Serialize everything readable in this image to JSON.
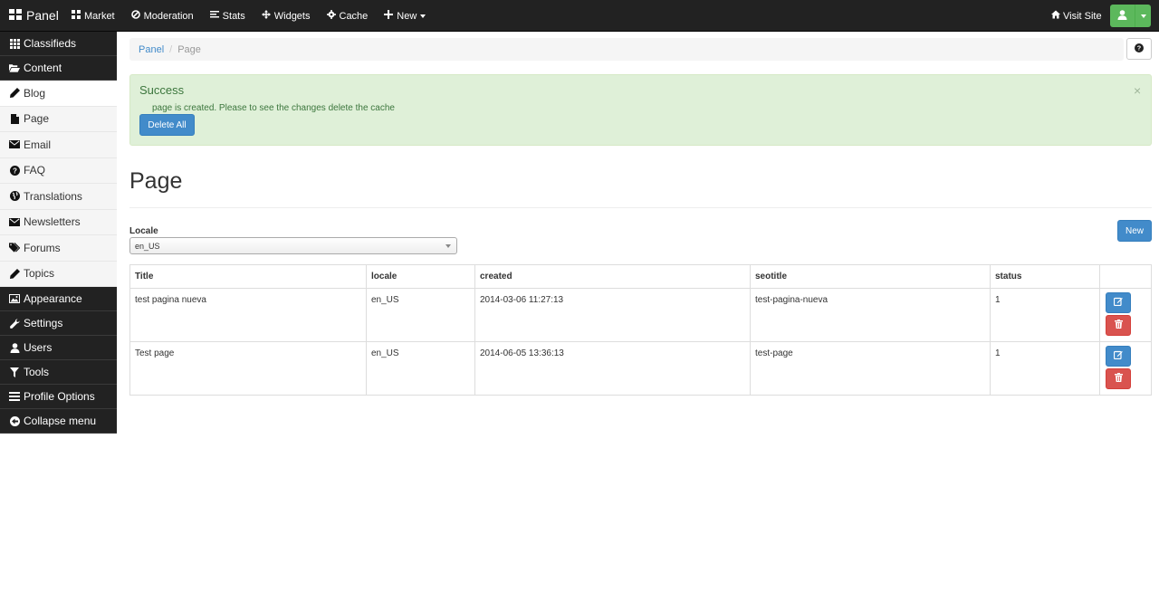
{
  "topbar": {
    "brand": "Panel",
    "nav": [
      {
        "label": "Market",
        "icon": "grid-icon"
      },
      {
        "label": "Moderation",
        "icon": "ban-icon"
      },
      {
        "label": "Stats",
        "icon": "align-left-icon"
      },
      {
        "label": "Widgets",
        "icon": "move-icon"
      },
      {
        "label": "Cache",
        "icon": "cog-icon"
      },
      {
        "label": "New",
        "icon": "plus-icon"
      }
    ],
    "visit_site": "Visit Site"
  },
  "sidebar": {
    "items": [
      {
        "label": "Classifieds",
        "icon": "th-icon",
        "style": "dark"
      },
      {
        "label": "Content",
        "icon": "folder-open-icon",
        "style": "dark"
      },
      {
        "label": "Blog",
        "icon": "pencil-icon",
        "style": "white"
      },
      {
        "label": "Page",
        "icon": "file-icon",
        "style": "light"
      },
      {
        "label": "Email",
        "icon": "envelope-icon",
        "style": "light"
      },
      {
        "label": "FAQ",
        "icon": "question-sign-icon",
        "style": "light"
      },
      {
        "label": "Translations",
        "icon": "globe-icon",
        "style": "light"
      },
      {
        "label": "Newsletters",
        "icon": "envelope-icon",
        "style": "light"
      },
      {
        "label": "Forums",
        "icon": "tags-icon",
        "style": "light"
      },
      {
        "label": "Topics",
        "icon": "pencil-icon",
        "style": "light"
      },
      {
        "label": "Appearance",
        "icon": "picture-icon",
        "style": "dark"
      },
      {
        "label": "Settings",
        "icon": "wrench-icon",
        "style": "dark"
      },
      {
        "label": "Users",
        "icon": "user-icon",
        "style": "dark"
      },
      {
        "label": "Tools",
        "icon": "filter-icon",
        "style": "dark"
      },
      {
        "label": "Profile Options",
        "icon": "list-icon",
        "style": "dark"
      },
      {
        "label": "Collapse menu",
        "icon": "circle-arrow-left-icon",
        "style": "dark"
      }
    ]
  },
  "breadcrumb": {
    "root": "Panel",
    "current": "Page"
  },
  "alert": {
    "title": "Success",
    "message": "page is created. Please to see the changes delete the cache",
    "button": "Delete All",
    "close": "×"
  },
  "page": {
    "title": "Page",
    "locale_label": "Locale",
    "locale_value": "en_US",
    "new_button": "New"
  },
  "table": {
    "headers": [
      "Title",
      "locale",
      "created",
      "seotitle",
      "status"
    ],
    "rows": [
      [
        "test pagina nueva",
        "en_US",
        "2014-03-06 11:27:13",
        "test-pagina-nueva",
        "1"
      ],
      [
        "Test page",
        "en_US",
        "2014-06-05 13:36:13",
        "test-page",
        "1"
      ]
    ]
  }
}
